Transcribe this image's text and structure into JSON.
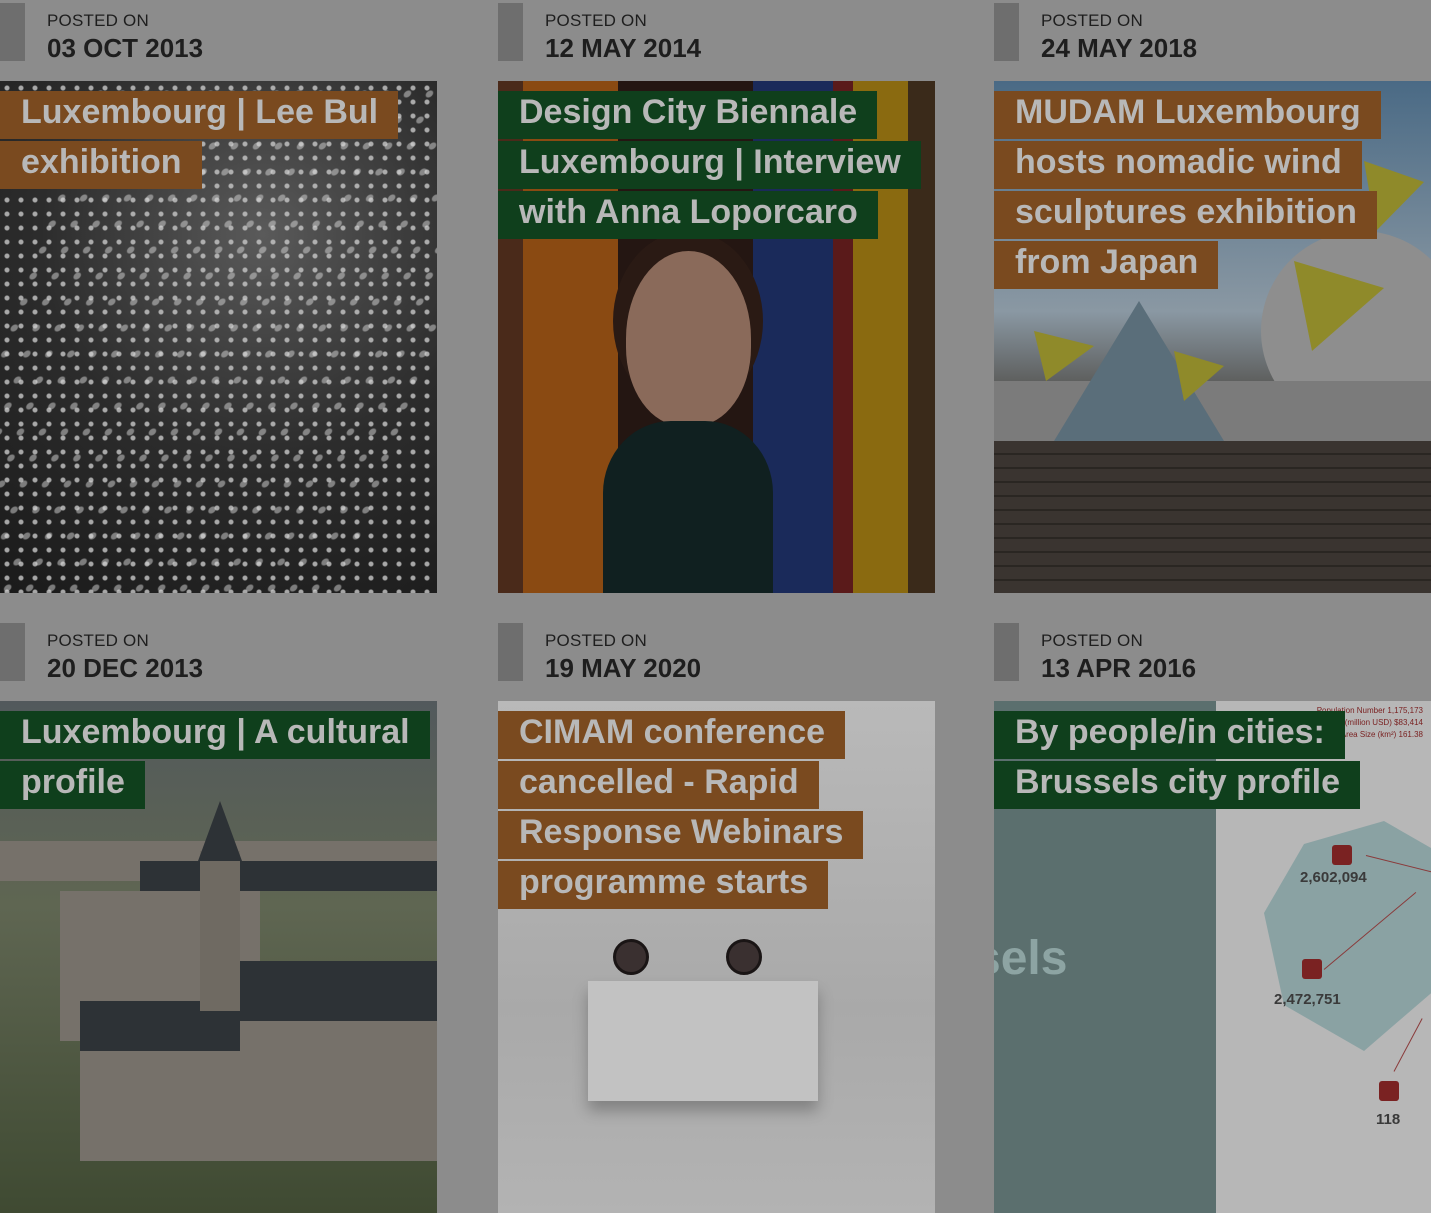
{
  "posted_label": "POSTED ON",
  "cards": [
    {
      "date": "03 OCT 2013",
      "title": "Luxembourg | Lee Bul exhibition",
      "tag_color": "orange"
    },
    {
      "date": "12 MAY 2014",
      "title": "Design City Biennale Luxembourg | Interview with Anna Loporcaro",
      "tag_color": "green"
    },
    {
      "date": "24 MAY 2018",
      "title": "MUDAM Luxembourg hosts nomadic wind sculptures exhibition from Japan",
      "tag_color": "orange"
    },
    {
      "date": "20 DEC 2013",
      "title": "Luxembourg | A cultural profile",
      "tag_color": "green"
    },
    {
      "date": "19 MAY 2020",
      "title": "CIMAM conference cancelled - Rapid Response Webinars programme starts",
      "tag_color": "orange"
    },
    {
      "date": "13 APR 2016",
      "title": "By people/in cities: Brussels city profile",
      "tag_color": "green"
    }
  ],
  "infographic": {
    "band_text": "sels",
    "stats": [
      "2,602,094",
      "2,472,751",
      "118"
    ],
    "legend": [
      "Population Number  1,175,173",
      "GDP (million USD)  $83,414",
      "Area Size (km²)  161.38"
    ]
  },
  "colors": {
    "overlay": "#8c8c8c",
    "orange_tag": "#7a4a1f",
    "green_tag": "#0f3f1c",
    "title_text": "#b8b8b8"
  }
}
